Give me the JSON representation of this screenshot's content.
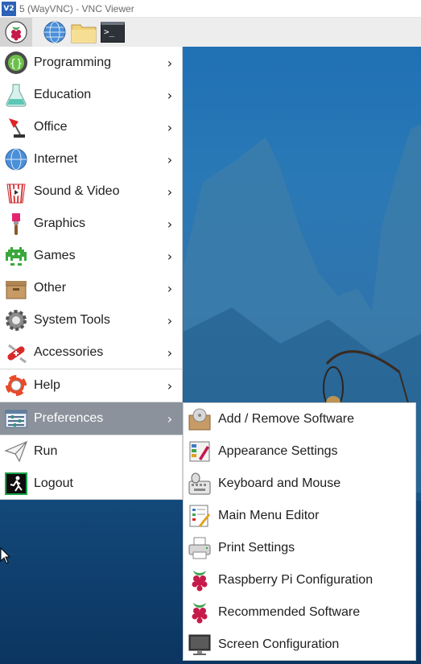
{
  "window": {
    "title": "5 (WayVNC) - VNC Viewer",
    "logo_text": "V2"
  },
  "panel": {
    "menu_button": "raspberry-icon",
    "launchers": [
      {
        "name": "web-browser",
        "icon": "globe-icon"
      },
      {
        "name": "file-manager",
        "icon": "folder-icon"
      },
      {
        "name": "terminal",
        "icon": "terminal-icon",
        "glyph": ">_"
      }
    ]
  },
  "main_menu": {
    "items": [
      {
        "label": "Programming",
        "icon": "programming-icon",
        "has_submenu": true
      },
      {
        "label": "Education",
        "icon": "education-icon",
        "has_submenu": true
      },
      {
        "label": "Office",
        "icon": "office-icon",
        "has_submenu": true
      },
      {
        "label": "Internet",
        "icon": "internet-icon",
        "has_submenu": true
      },
      {
        "label": "Sound & Video",
        "icon": "sound-video-icon",
        "has_submenu": true
      },
      {
        "label": "Graphics",
        "icon": "graphics-icon",
        "has_submenu": true
      },
      {
        "label": "Games",
        "icon": "games-icon",
        "has_submenu": true
      },
      {
        "label": "Other",
        "icon": "other-icon",
        "has_submenu": true
      },
      {
        "label": "System Tools",
        "icon": "system-tools-icon",
        "has_submenu": true
      },
      {
        "label": "Accessories",
        "icon": "accessories-icon",
        "has_submenu": true
      },
      {
        "label": "Help",
        "icon": "help-icon",
        "has_submenu": true
      },
      {
        "label": "Preferences",
        "icon": "preferences-icon",
        "has_submenu": true,
        "active": true
      },
      {
        "label": "Run",
        "icon": "run-icon",
        "has_submenu": false
      },
      {
        "label": "Logout",
        "icon": "logout-icon",
        "has_submenu": false
      }
    ],
    "arrow": "›"
  },
  "preferences_menu": {
    "items": [
      {
        "label": "Add / Remove Software",
        "icon": "package-install-icon"
      },
      {
        "label": "Appearance Settings",
        "icon": "appearance-icon"
      },
      {
        "label": "Keyboard and Mouse",
        "icon": "keyboard-mouse-icon"
      },
      {
        "label": "Main Menu Editor",
        "icon": "menu-editor-icon"
      },
      {
        "label": "Print Settings",
        "icon": "printer-icon"
      },
      {
        "label": "Raspberry Pi Configuration",
        "icon": "raspberry-icon"
      },
      {
        "label": "Recommended Software",
        "icon": "raspberry-icon"
      },
      {
        "label": "Screen Configuration",
        "icon": "monitor-icon"
      }
    ]
  },
  "colors": {
    "active_item": "#8b929c",
    "desktop_blue": "#2a79b6",
    "panel": "#ededed"
  }
}
